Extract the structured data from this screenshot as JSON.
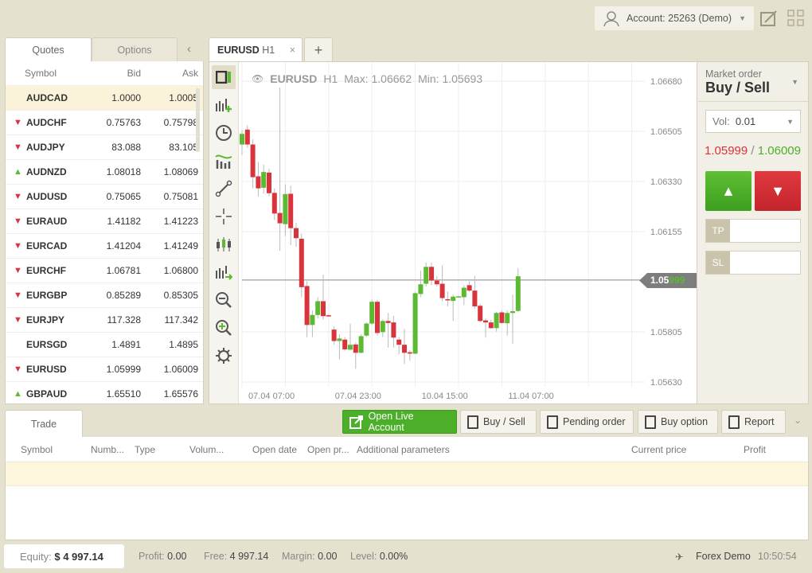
{
  "topbar": {
    "account": "Account: 25263 (Demo)",
    "icons": [
      "user-icon",
      "chevron-down-icon",
      "chart-edit-icon",
      "grid-layout-icon"
    ]
  },
  "left": {
    "tabs": [
      "Quotes",
      "Options"
    ],
    "headers": {
      "symbol": "Symbol",
      "bid": "Bid",
      "ask": "Ask"
    },
    "quotes": [
      {
        "symbol": "AUDCAD",
        "bid": "1.0000",
        "ask": "1.0005",
        "trend": "none"
      },
      {
        "symbol": "AUDCHF",
        "bid": "0.75763",
        "ask": "0.75798",
        "trend": "down"
      },
      {
        "symbol": "AUDJPY",
        "bid": "83.088",
        "ask": "83.105",
        "trend": "down"
      },
      {
        "symbol": "AUDNZD",
        "bid": "1.08018",
        "ask": "1.08069",
        "trend": "up"
      },
      {
        "symbol": "AUDUSD",
        "bid": "0.75065",
        "ask": "0.75081",
        "trend": "down"
      },
      {
        "symbol": "EURAUD",
        "bid": "1.41182",
        "ask": "1.41223",
        "trend": "down"
      },
      {
        "symbol": "EURCAD",
        "bid": "1.41204",
        "ask": "1.41249",
        "trend": "down"
      },
      {
        "symbol": "EURCHF",
        "bid": "1.06781",
        "ask": "1.06800",
        "trend": "down"
      },
      {
        "symbol": "EURGBP",
        "bid": "0.85289",
        "ask": "0.85305",
        "trend": "down"
      },
      {
        "symbol": "EURJPY",
        "bid": "117.328",
        "ask": "117.342",
        "trend": "down"
      },
      {
        "symbol": "EURSGD",
        "bid": "1.4891",
        "ask": "1.4895",
        "trend": "none"
      },
      {
        "symbol": "EURUSD",
        "bid": "1.05999",
        "ask": "1.06009",
        "trend": "down"
      },
      {
        "symbol": "GBPAUD",
        "bid": "1.65510",
        "ask": "1.65576",
        "trend": "up"
      }
    ]
  },
  "chart_tab": {
    "symbol": "EURUSD",
    "tf": "H1",
    "close": "×",
    "add": "+"
  },
  "chart_info": {
    "symbol": "EURUSD",
    "tf": "H1",
    "max": "Max: 1.06662",
    "min": "Min: 1.05693"
  },
  "price_tag": {
    "main": "1.05",
    "tail": "999"
  },
  "colors": {
    "up": "#5cb932",
    "down": "#d9333b",
    "accent_green": "#4caf2a"
  },
  "chart_data": {
    "type": "candlestick",
    "yticks": [
      "1.06680",
      "1.06505",
      "1.06330",
      "1.06155",
      "1.05805",
      "1.05630"
    ],
    "ylim": [
      1.0563,
      1.0668
    ],
    "xticks": [
      {
        "index": 0,
        "label": "07.04 07:00"
      },
      {
        "index": 16,
        "label": "07.04 23:00"
      },
      {
        "index": 32,
        "label": "10.04 15:00"
      },
      {
        "index": 48,
        "label": "11.04 07:00"
      }
    ],
    "current_price": 1.05986,
    "ohlc": [
      [
        1.06459,
        1.0651,
        1.06422,
        1.06496
      ],
      [
        1.06511,
        1.06526,
        1.06447,
        1.06459
      ],
      [
        1.06459,
        1.06477,
        1.06306,
        1.06345
      ],
      [
        1.06348,
        1.06398,
        1.06278,
        1.06306
      ],
      [
        1.06308,
        1.06389,
        1.06287,
        1.06363
      ],
      [
        1.06361,
        1.06375,
        1.06278,
        1.06289
      ],
      [
        1.0629,
        1.06306,
        1.06195,
        1.06218
      ],
      [
        1.0622,
        1.06658,
        1.06088,
        1.06184
      ],
      [
        1.06181,
        1.0632,
        1.06139,
        1.06286
      ],
      [
        1.06287,
        1.06315,
        1.06107,
        1.06167
      ],
      [
        1.06167,
        1.06186,
        1.06102,
        1.06132
      ],
      [
        1.0613,
        1.06148,
        1.05926,
        1.05961
      ],
      [
        1.05965,
        1.05982,
        1.05787,
        1.05829
      ],
      [
        1.05829,
        1.0588,
        1.05787,
        1.05864
      ],
      [
        1.05864,
        1.05926,
        1.05852,
        1.05912
      ],
      [
        1.05912,
        1.06005,
        1.05848,
        1.0586
      ],
      [
        1.05863,
        1.05866,
        1.05857,
        1.0586
      ],
      [
        1.05813,
        1.05824,
        1.0576,
        1.05773
      ],
      [
        1.05773,
        1.05797,
        1.05709,
        1.05782
      ],
      [
        1.05778,
        1.05787,
        1.05739,
        1.05744
      ],
      [
        1.05743,
        1.05834,
        1.05739,
        1.0576
      ],
      [
        1.05761,
        1.05769,
        1.05676,
        1.05732
      ],
      [
        1.05732,
        1.05797,
        1.0573,
        1.0579
      ],
      [
        1.05792,
        1.05838,
        1.05787,
        1.05834
      ],
      [
        1.05834,
        1.05917,
        1.05829,
        1.0591
      ],
      [
        1.0591,
        1.05917,
        1.05792,
        1.05801
      ],
      [
        1.05804,
        1.05848,
        1.05787,
        1.05843
      ],
      [
        1.05843,
        1.05871,
        1.0575,
        1.05836
      ],
      [
        1.05838,
        1.05861,
        1.0575,
        1.05785
      ],
      [
        1.05778,
        1.05787,
        1.05727,
        1.0576
      ],
      [
        1.0576,
        1.05815,
        1.05693,
        1.05732
      ],
      [
        1.05734,
        1.05741,
        1.05704,
        1.05729
      ],
      [
        1.05729,
        1.05945,
        1.05727,
        1.0594
      ],
      [
        1.05937,
        1.06019,
        1.05926,
        1.05971
      ],
      [
        1.05973,
        1.06047,
        1.05963,
        1.06032
      ],
      [
        1.06032,
        1.06047,
        1.05968,
        1.05984
      ],
      [
        1.05984,
        1.06,
        1.05963,
        1.05971
      ],
      [
        1.05973,
        1.06037,
        1.05912,
        1.05923
      ],
      [
        1.05919,
        1.05945,
        1.05894,
        1.05915
      ],
      [
        1.05913,
        1.05935,
        1.05843,
        1.05928
      ],
      [
        1.05926,
        1.05931,
        1.05924,
        1.05929
      ],
      [
        1.05926,
        1.05968,
        1.05898,
        1.05959
      ],
      [
        1.05968,
        1.05982,
        1.05945,
        1.05949
      ],
      [
        1.05949,
        1.06,
        1.05885,
        1.05894
      ],
      [
        1.05896,
        1.05903,
        1.05838,
        1.05843
      ],
      [
        1.05845,
        1.05852,
        1.05785,
        1.05838
      ],
      [
        1.05838,
        1.05848,
        1.05815,
        1.05818
      ],
      [
        1.05818,
        1.05875,
        1.05806,
        1.05871
      ],
      [
        1.05873,
        1.0588,
        1.05834,
        1.05836
      ],
      [
        1.05835,
        1.0588,
        1.05792,
        1.05871
      ],
      [
        1.05871,
        1.05935,
        1.05764,
        1.05877
      ],
      [
        1.05878,
        1.06028,
        1.05875,
        1.05999
      ]
    ]
  },
  "order": {
    "label": "Market order",
    "title": "Buy / Sell",
    "vol_label": "Vol:",
    "vol": "0.01",
    "bid": "1.05999",
    "sep": " / ",
    "ask": "1.06009",
    "tp": "TP",
    "sl": "SL",
    "tp_value": "",
    "sl_value": ""
  },
  "bottom": {
    "tab": "Trade",
    "buttons": [
      "Open Live Account",
      "Buy / Sell",
      "Pending order",
      "Buy option",
      "Report"
    ],
    "columns": [
      "Symbol",
      "Numb...",
      "Type",
      "Volum...",
      "Open date",
      "Open pr...",
      "Additional parameters",
      "Current price",
      "Profit"
    ]
  },
  "status": {
    "equity_label": "Equity:",
    "equity": "$ 4 997.14",
    "profit_label": "Profit:",
    "profit": "0.00",
    "free_label": "Free:",
    "free": "4 997.14",
    "margin_label": "Margin:",
    "margin": "0.00",
    "level_label": "Level:",
    "level": "0.00%",
    "server": "Forex Demo",
    "time": "10:50:54"
  }
}
